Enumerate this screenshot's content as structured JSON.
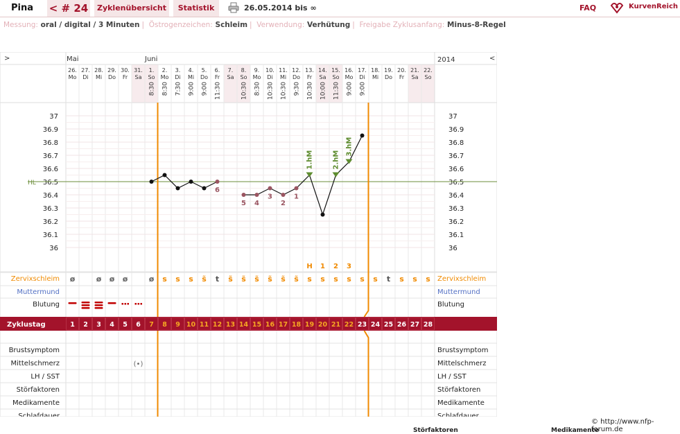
{
  "header": {
    "name": "Pina",
    "cycle_label": "< # 24",
    "overview_label": "Zyklenübersicht",
    "stats_label": "Statistik",
    "period": "26.05.2014 bis ∞",
    "faq_label": "FAQ",
    "brand": "KurvenReich",
    "colors": {
      "accent": "#a3132b",
      "tab_bg": "#f5e6e7"
    }
  },
  "info": {
    "messung_key": "Messung:",
    "messung_val": "oral / digital / 3 Minuten",
    "oestro_key": "Östrogenzeichen:",
    "oestro_val": "Schleim",
    "verwendung_key": "Verwendung:",
    "verwendung_val": "Verhütung",
    "freigabe_key": "Freigabe Zyklusanfang:",
    "freigabe_val": "Minus-8-Regel"
  },
  "chart_data": {
    "type": "line",
    "nav_left": ">",
    "nav_right": "<",
    "months": [
      "Mai",
      "Juni"
    ],
    "year": "2014",
    "days": [
      {
        "d": "26.",
        "wd": "Mo",
        "t": ""
      },
      {
        "d": "27.",
        "wd": "Di",
        "t": ""
      },
      {
        "d": "28.",
        "wd": "Mi",
        "t": ""
      },
      {
        "d": "29.",
        "wd": "Do",
        "t": ""
      },
      {
        "d": "30.",
        "wd": "Fr",
        "t": ""
      },
      {
        "d": "31.",
        "wd": "Sa",
        "t": "",
        "we": true
      },
      {
        "d": "1.",
        "wd": "So",
        "t": "8:30",
        "we": true
      },
      {
        "d": "2.",
        "wd": "Mo",
        "t": "8:30"
      },
      {
        "d": "3.",
        "wd": "Di",
        "t": "7:30"
      },
      {
        "d": "4.",
        "wd": "Mi",
        "t": "9:00"
      },
      {
        "d": "5.",
        "wd": "Do",
        "t": "9:00"
      },
      {
        "d": "6.",
        "wd": "Fr",
        "t": "11:30"
      },
      {
        "d": "7.",
        "wd": "Sa",
        "t": "",
        "we": true
      },
      {
        "d": "8.",
        "wd": "So",
        "t": "10:30",
        "we": true
      },
      {
        "d": "9.",
        "wd": "Mo",
        "t": "8:30"
      },
      {
        "d": "10.",
        "wd": "Di",
        "t": "10:30"
      },
      {
        "d": "11.",
        "wd": "Mi",
        "t": "10:30"
      },
      {
        "d": "12.",
        "wd": "Do",
        "t": "9:30"
      },
      {
        "d": "13.",
        "wd": "Fr",
        "t": "10:30"
      },
      {
        "d": "14.",
        "wd": "Sa",
        "t": "10:00",
        "we": true
      },
      {
        "d": "15.",
        "wd": "So",
        "t": "11:30",
        "we": true
      },
      {
        "d": "16.",
        "wd": "Mo",
        "t": "9:00"
      },
      {
        "d": "17.",
        "wd": "Di",
        "t": "9:00"
      },
      {
        "d": "18.",
        "wd": "Mi",
        "t": ""
      },
      {
        "d": "19.",
        "wd": "Do",
        "t": ""
      },
      {
        "d": "20.",
        "wd": "Fr",
        "t": ""
      },
      {
        "d": "21.",
        "wd": "Sa",
        "t": "",
        "we": true
      },
      {
        "d": "22.",
        "wd": "So",
        "t": "",
        "we": true
      }
    ],
    "y_ticks": [
      "37",
      "36.9",
      "36.8",
      "36.7",
      "36.6",
      "36.5",
      "36.4",
      "36.3",
      "36.2",
      "36.1",
      "36"
    ],
    "ylim": [
      36.0,
      37.0
    ],
    "hl_label": "HL",
    "hl_value": 36.5,
    "series": [
      {
        "points": [
          {
            "day": 7,
            "y": 36.5
          },
          {
            "day": 8,
            "y": 36.55
          },
          {
            "day": 9,
            "y": 36.45
          },
          {
            "day": 10,
            "y": 36.5
          },
          {
            "day": 11,
            "y": 36.45
          },
          {
            "day": 12,
            "y": 36.5,
            "lbl": "6"
          },
          {
            "day": 14,
            "y": 36.4,
            "lbl": "5"
          },
          {
            "day": 15,
            "y": 36.4,
            "lbl": "4"
          },
          {
            "day": 16,
            "y": 36.45,
            "lbl": "3"
          },
          {
            "day": 17,
            "y": 36.4,
            "lbl": "2"
          },
          {
            "day": 18,
            "y": 36.45,
            "lbl": "1"
          },
          {
            "day": 19,
            "y": 36.55,
            "hm": "1.hM"
          },
          {
            "day": 20,
            "y": 36.25
          },
          {
            "day": 21,
            "y": 36.55,
            "hm": "2.hM"
          },
          {
            "day": 22,
            "y": 36.65,
            "hm": "3.hM"
          },
          {
            "day": 23,
            "y": 36.85
          }
        ]
      }
    ],
    "peak_labels": [
      {
        "day": 18,
        "t": "H"
      },
      {
        "day": 19,
        "t": "1"
      },
      {
        "day": 20,
        "t": "2"
      },
      {
        "day": 21,
        "t": "3"
      }
    ],
    "cervix_label": "Zervixschleim",
    "cervix": [
      "",
      "ø",
      "",
      "ø",
      "ø",
      "ø",
      "",
      "ø",
      "s",
      "s",
      "s",
      "s̃",
      "t",
      "s̃",
      "s̃",
      "s̃",
      "s̃",
      "s̃",
      "s̃",
      "s",
      "s",
      "s",
      "s",
      "s",
      "s",
      "t",
      "s",
      "s",
      "s"
    ],
    "muttermund_label": "Muttermund",
    "blutung_label": "Blutung",
    "blutung": [
      "",
      "stark",
      "sehr stark",
      "sehr stark",
      "mittel",
      "schmier",
      "schmier"
    ],
    "zyklustag_label": "Zyklustag",
    "zyklustage": [
      "1",
      "2",
      "3",
      "4",
      "5",
      "6",
      "7",
      "8",
      "9",
      "10",
      "11",
      "12",
      "13",
      "14",
      "15",
      "16",
      "17",
      "18",
      "19",
      "20",
      "21",
      "22",
      "23",
      "24",
      "25",
      "26",
      "27",
      "28"
    ],
    "lower_rows": [
      "Brustsymptom",
      "Mittelschmerz",
      "LH / SST",
      "Störfaktoren",
      "Medikamente",
      "Schlafdauer"
    ],
    "mittelschmerz_symbol": "(•)",
    "mittelschmerz_day": 6,
    "lines": {
      "cycle_start_day": 7,
      "cover_end_day": 22
    }
  },
  "footer": {
    "copyright": "© http://www.nfp-forum.de",
    "partial1": "Störfaktoren",
    "partial2": "Medikamente"
  }
}
